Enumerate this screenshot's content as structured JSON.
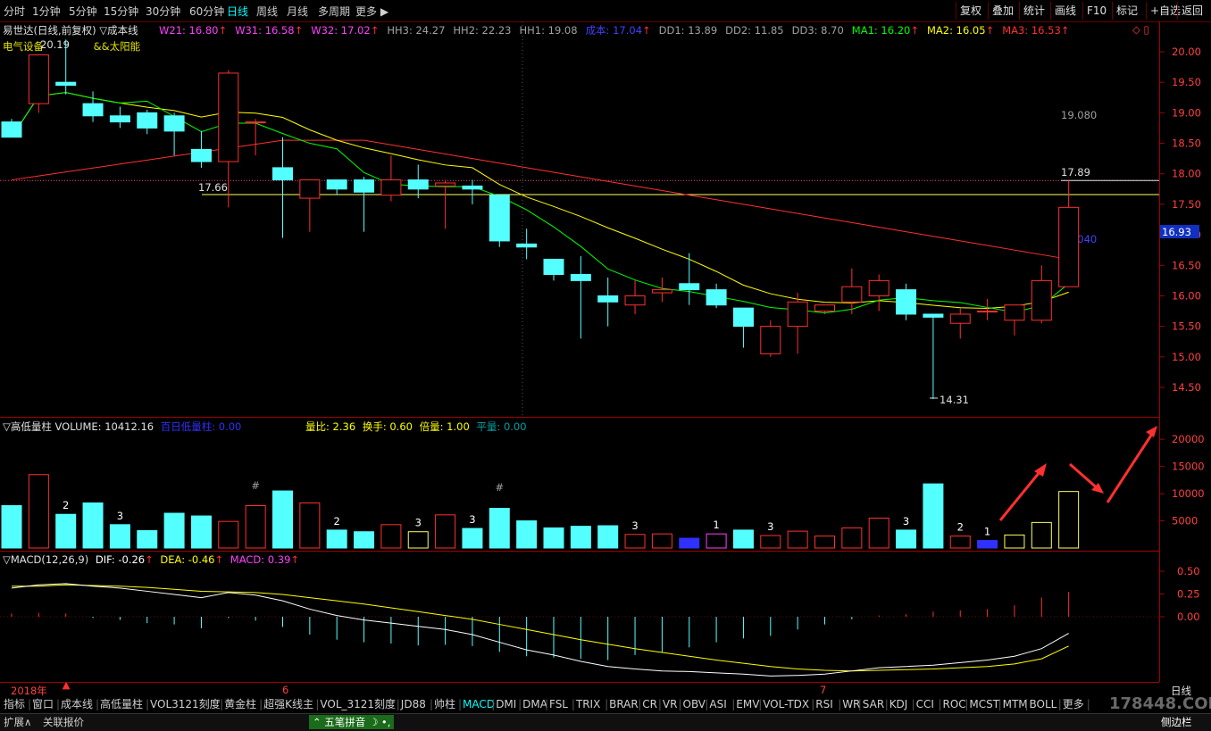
{
  "toolbar": {
    "timeframes": [
      "分时",
      "1分钟",
      "5分钟",
      "15分钟",
      "30分钟",
      "60分钟",
      "日线",
      "周线",
      "月线",
      "多周期",
      "更多"
    ],
    "active_timeframe": "日线",
    "right_buttons": [
      "复权",
      "叠加",
      "统计",
      "画线",
      "F10",
      "标记",
      "+自选",
      "返回"
    ]
  },
  "stock": {
    "title": "易世达(日线,前复权)",
    "indicator": "成本线",
    "sector": "电气设备",
    "sector_extra": "&&太阳能"
  },
  "main_indicators": [
    {
      "label": "W21: 16.80",
      "color": "#ff40ff"
    },
    {
      "label": "W31: 16.58",
      "color": "#ff40ff"
    },
    {
      "label": "W32: 17.02",
      "color": "#ff40ff"
    },
    {
      "label": "HH3: 24.27",
      "color": "#a0a0a0"
    },
    {
      "label": "HH2: 22.23",
      "color": "#a0a0a0"
    },
    {
      "label": "HH1: 19.08",
      "color": "#a0a0a0"
    },
    {
      "label": "成本: 17.04",
      "color": "#4040ff"
    },
    {
      "label": "DD1: 13.89",
      "color": "#a0a0a0"
    },
    {
      "label": "DD2: 11.85",
      "color": "#a0a0a0"
    },
    {
      "label": "DD3: 8.70",
      "color": "#a0a0a0"
    },
    {
      "label": "MA1: 16.20",
      "color": "#00ff00"
    },
    {
      "label": "MA2: 16.05",
      "color": "#ffff00"
    },
    {
      "label": "MA3: 16.53",
      "color": "#ff3030"
    }
  ],
  "price_axis": [
    "20.00",
    "19.50",
    "19.00",
    "18.50",
    "18.00",
    "17.50",
    "17.00",
    "16.50",
    "16.00",
    "15.50",
    "15.00",
    "14.50"
  ],
  "price_annotations": {
    "hh1": "19.080",
    "high": "17.89",
    "level": "17.66",
    "cost": "17.040",
    "low": "14.31",
    "current": "16.93",
    "top_left": "20.19"
  },
  "volume_panel": {
    "title": "高低量柱",
    "volume": "VOLUME: 10412.16",
    "low_label": "百日低量柱: 0.00",
    "ratio": "量比: 2.36",
    "turnover": "换手: 0.60",
    "multiple": "倍量: 1.00",
    "flat": "平量: 0.00",
    "axis": [
      "20000",
      "15000",
      "10000",
      "5000"
    ]
  },
  "macd_panel": {
    "title": "MACD(12,26,9)",
    "dif": "DIF: -0.26",
    "dea": "DEA: -0.46",
    "macd": "MACD: 0.39",
    "axis": [
      "0.50",
      "0.25",
      "0.00"
    ]
  },
  "date_axis": {
    "year": "2018年",
    "m6": "6",
    "m7": "7",
    "period": "日线"
  },
  "bottom_tabs": [
    "指标",
    "窗口",
    "成本线",
    "高低量柱",
    "VOL3121刻度",
    "黄金柱",
    "超强K线主",
    "VOL_3121刻度",
    "JD88",
    "帅柱",
    "MACD",
    "DMI",
    "DMA",
    "FSL",
    "TRIX",
    "BRAR",
    "CR",
    "VR",
    "OBV",
    "ASI",
    "EMV",
    "VOL-TDX",
    "RSI",
    "WR",
    "SAR",
    "KDJ",
    "CCI",
    "ROC",
    "MCST",
    "MTM",
    "BOLL",
    "更多"
  ],
  "active_tab": "MACD",
  "status": {
    "expand": "扩展∧",
    "quote": "关联报价",
    "ime": "五笔拼音",
    "sidebar": "侧边栏"
  },
  "watermark": "178448.COM",
  "chart_data": {
    "type": "candlestick",
    "candles": [
      [
        18.85,
        18.6,
        18.9,
        18.6
      ],
      [
        19.15,
        19.95,
        19.95,
        19.0
      ],
      [
        19.5,
        19.45,
        20.2,
        19.3
      ],
      [
        19.15,
        18.95,
        19.35,
        18.85
      ],
      [
        18.95,
        18.85,
        19.1,
        18.75
      ],
      [
        19.0,
        18.75,
        19.05,
        18.65
      ],
      [
        18.95,
        18.7,
        19.0,
        18.3
      ],
      [
        18.4,
        18.2,
        18.7,
        18.1
      ],
      [
        18.2,
        19.65,
        19.7,
        17.45
      ],
      [
        18.85,
        18.85,
        18.9,
        18.3
      ],
      [
        18.1,
        17.9,
        18.6,
        16.95
      ],
      [
        17.6,
        17.9,
        17.9,
        17.05
      ],
      [
        17.9,
        17.75,
        17.9,
        17.65
      ],
      [
        17.9,
        17.7,
        17.95,
        17.05
      ],
      [
        17.65,
        17.9,
        18.3,
        17.55
      ],
      [
        17.9,
        17.75,
        18.15,
        17.6
      ],
      [
        17.8,
        17.85,
        17.9,
        17.1
      ],
      [
        17.8,
        17.75,
        17.9,
        17.5
      ],
      [
        17.65,
        16.9,
        17.65,
        16.8
      ],
      [
        16.85,
        16.8,
        17.1,
        16.6
      ],
      [
        16.6,
        16.35,
        16.6,
        16.25
      ],
      [
        16.35,
        16.25,
        16.65,
        15.3
      ],
      [
        16.0,
        15.9,
        16.3,
        15.5
      ],
      [
        15.85,
        16.0,
        16.25,
        15.7
      ],
      [
        16.05,
        16.1,
        16.3,
        15.9
      ],
      [
        16.2,
        16.1,
        16.7,
        15.85
      ],
      [
        16.1,
        15.85,
        16.2,
        15.8
      ],
      [
        15.8,
        15.5,
        15.8,
        15.15
      ],
      [
        15.05,
        15.5,
        15.6,
        15.0
      ],
      [
        15.5,
        15.9,
        16.05,
        15.05
      ],
      [
        15.75,
        15.85,
        15.85,
        15.7
      ],
      [
        15.9,
        16.15,
        16.45,
        15.7
      ],
      [
        16.0,
        16.25,
        16.35,
        15.75
      ],
      [
        16.1,
        15.7,
        16.2,
        15.6
      ],
      [
        15.7,
        15.65,
        15.7,
        14.31
      ],
      [
        15.55,
        15.7,
        15.8,
        15.3
      ],
      [
        15.75,
        15.75,
        15.95,
        15.6
      ],
      [
        15.6,
        15.85,
        15.85,
        15.35
      ],
      [
        15.6,
        16.25,
        16.5,
        15.55
      ],
      [
        16.15,
        17.45,
        17.89,
        16.15
      ]
    ],
    "volume": [
      7800,
      13500,
      6200,
      8300,
      4300,
      3200,
      6400,
      5900,
      4900,
      7800,
      10500,
      8300,
      3300,
      3000,
      4300,
      3000,
      6100,
      3600,
      7300,
      5000,
      3700,
      4000,
      4100,
      2500,
      2600,
      1800,
      2600,
      3300,
      2300,
      3100,
      2200,
      3700,
      5500,
      3300,
      11800,
      2200,
      1400,
      2400,
      4700,
      10400
    ],
    "macd_dif": [
      0.45,
      0.5,
      0.52,
      0.48,
      0.45,
      0.4,
      0.35,
      0.3,
      0.38,
      0.34,
      0.25,
      0.12,
      0.02,
      -0.05,
      -0.1,
      -0.15,
      -0.2,
      -0.28,
      -0.4,
      -0.52,
      -0.6,
      -0.7,
      -0.78,
      -0.82,
      -0.85,
      -0.86,
      -0.88,
      -0.9,
      -0.93,
      -0.92,
      -0.9,
      -0.85,
      -0.8,
      -0.78,
      -0.76,
      -0.72,
      -0.68,
      -0.62,
      -0.5,
      -0.26
    ],
    "macd_dea": [
      0.48,
      0.48,
      0.5,
      0.49,
      0.48,
      0.46,
      0.43,
      0.4,
      0.39,
      0.38,
      0.35,
      0.3,
      0.25,
      0.2,
      0.14,
      0.08,
      0.02,
      -0.04,
      -0.12,
      -0.2,
      -0.28,
      -0.36,
      -0.43,
      -0.5,
      -0.56,
      -0.62,
      -0.68,
      -0.73,
      -0.78,
      -0.82,
      -0.84,
      -0.85,
      -0.84,
      -0.83,
      -0.82,
      -0.8,
      -0.78,
      -0.74,
      -0.66,
      -0.46
    ],
    "macd_hist": [
      0.05,
      0.06,
      0.05,
      -0.02,
      -0.05,
      -0.1,
      -0.12,
      -0.18,
      -0.02,
      -0.06,
      -0.16,
      -0.28,
      -0.36,
      -0.4,
      -0.42,
      -0.45,
      -0.44,
      -0.46,
      -0.55,
      -0.62,
      -0.64,
      -0.66,
      -0.68,
      -0.6,
      -0.56,
      -0.48,
      -0.4,
      -0.34,
      -0.3,
      -0.2,
      -0.12,
      -0.04,
      0.02,
      0.04,
      0.08,
      0.1,
      0.12,
      0.18,
      0.3,
      0.39
    ],
    "ylim_price": [
      14.2,
      20.2
    ],
    "ylim_volume": [
      0,
      22000
    ],
    "ylim_macd": [
      -1.0,
      0.65
    ]
  }
}
